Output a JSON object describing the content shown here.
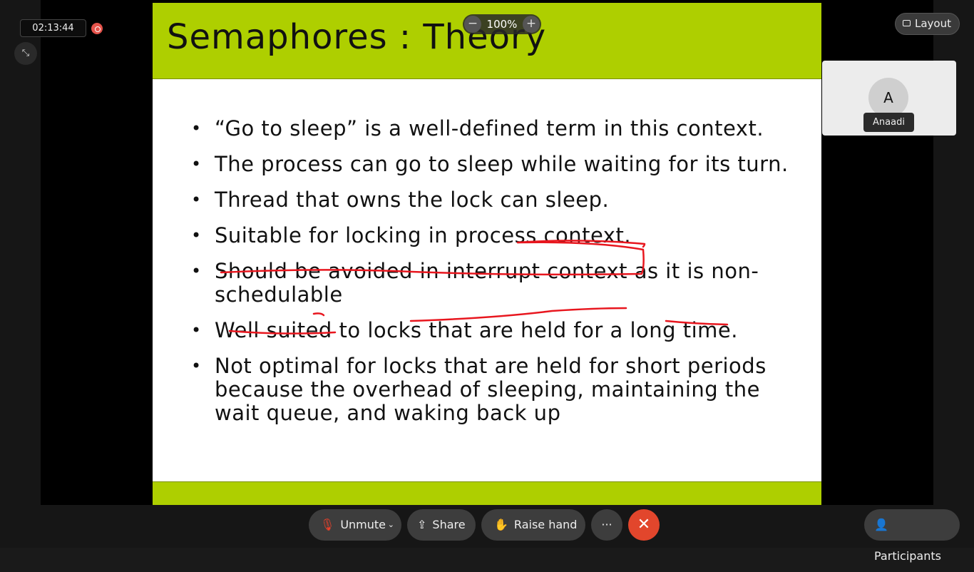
{
  "recording": {
    "elapsed": "02:13:44"
  },
  "zoom": {
    "level": "100%",
    "minus": "−",
    "plus": "+"
  },
  "slide": {
    "title": "Semaphores : Theory",
    "bullets": [
      "“Go to sleep” is a well-defined term in this context.",
      "The process can go to sleep while waiting for its turn.",
      "Thread that owns the lock can sleep.",
      "Suitable for locking in process context.",
      "Should be avoided in interrupt context as it is non-schedulable",
      "Well suited to locks that are held for a long time.",
      "Not optimal for locks that are held for short periods because the overhead of sleeping, maintaining the wait queue, and waking back up"
    ],
    "annotation_color": "#e8161e",
    "accent_color": "#aecf00"
  },
  "top_right": {
    "layout_label": "Layout"
  },
  "participant": {
    "initial": "A",
    "name": "Anaadi"
  },
  "controls": {
    "unmute_label": "Unmute",
    "share_label": "Share",
    "raise_hand_label": "Raise hand",
    "more_label": "···",
    "participants_label": "Participants",
    "end_color": "#e2462c"
  },
  "icons": {
    "collapse": "collapse-icon",
    "mic_muted": "mic-muted-icon",
    "share": "share-icon",
    "hand": "hand-icon",
    "end": "end-call-icon",
    "participants": "participants-icon",
    "layout": "layout-icon"
  }
}
